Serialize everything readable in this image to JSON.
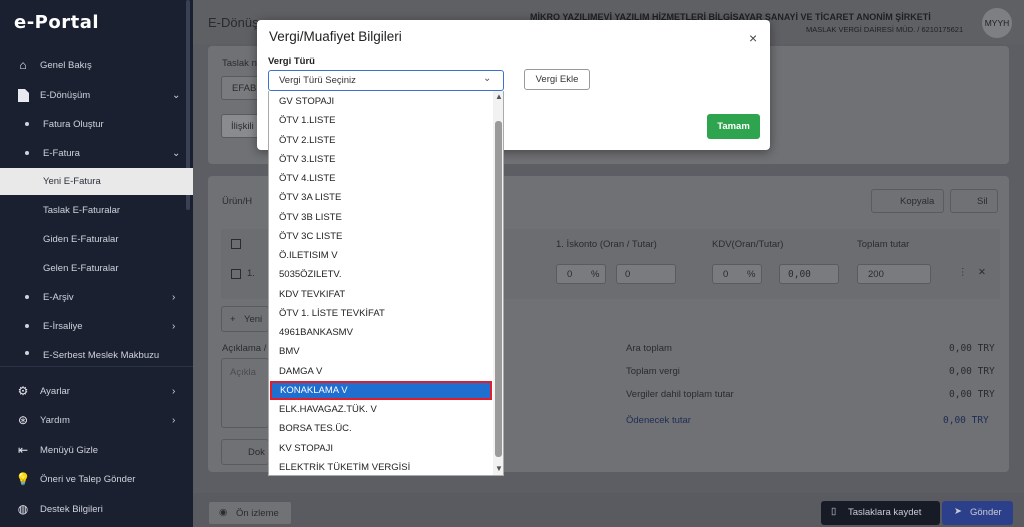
{
  "app": {
    "logo": "e-Portal"
  },
  "sidebar": {
    "items": [
      {
        "label": "Genel Bakış",
        "icon": "home-icon"
      },
      {
        "label": "E-Dönüşüm",
        "icon": "document-icon"
      },
      {
        "label": "Fatura Oluştur"
      },
      {
        "label": "E-Fatura"
      },
      {
        "label": "Yeni E-Fatura"
      },
      {
        "label": "Taslak E-Faturalar"
      },
      {
        "label": "Giden E-Faturalar"
      },
      {
        "label": "Gelen E-Faturalar"
      },
      {
        "label": "E-Arşiv"
      },
      {
        "label": "E-İrsaliye"
      },
      {
        "label": "E-Serbest Meslek Makbuzu"
      },
      {
        "label": "Ayarlar",
        "icon": "gear-icon"
      },
      {
        "label": "Yardım",
        "icon": "help-icon"
      },
      {
        "label": "Menüyü Gizle",
        "icon": "collapse-icon"
      },
      {
        "label": "Öneri ve Talep Gönder",
        "icon": "lightbulb-icon"
      },
      {
        "label": "Destek Bilgileri",
        "icon": "support-icon"
      }
    ]
  },
  "header": {
    "page_title": "E-Dönüş",
    "company": "MİKRO YAZILIMEVİ YAZILIM HİZMETLERİ BİLGİSAYAR SANAYİ VE TİCARET ANONİM ŞİRKETİ",
    "tax_office": "MASLAK VERGİ DAİRESİ MÜD. / 6210175621",
    "avatar": "MYYH"
  },
  "background": {
    "taslak_label": "Taslak n",
    "efab": "EFAB",
    "iliskili": "İlişkili",
    "products_title": "Ürün/H",
    "kopyala": "Kopyala",
    "sil": "Sil",
    "col_discount": "1. İskonto (Oran / Tutar)",
    "col_kdv": "KDV(Oran/Tutar)",
    "col_total": "Toplam tutar",
    "row_no": "1.",
    "disc_rate": "0",
    "disc_pct": "%",
    "disc_amt": "0",
    "kdv_rate": "0",
    "kdv_pct": "%",
    "kdv_amt": "0,00",
    "total_amt": "200",
    "new_row": "Yeni",
    "aciklama": "Açıklama /",
    "aciklama_ph": "Açıkla",
    "dok": "Dok",
    "ara_toplam": "Ara toplam",
    "ara_toplam_val": "0,00 TRY",
    "toplam_vergi": "Toplam vergi",
    "toplam_vergi_val": "0,00 TRY",
    "vergiler_dahil": "Vergiler dahil toplam tutar",
    "vergiler_dahil_val": "0,00 TRY",
    "odenecek": "Ödenecek tutar",
    "odenecek_val": "0,00 TRY",
    "on_izleme": "Ön izleme",
    "taslaklara_kaydet": "Taslaklara kaydet",
    "gonder": "Gönder"
  },
  "modal": {
    "title": "Vergi/Muafiyet Bilgileri",
    "close": "×",
    "tax_type_label": "Vergi Türü",
    "select_placeholder": "Vergi Türü Seçiniz",
    "add_tax": "Vergi Ekle",
    "ok": "Tamam",
    "options": [
      "GV STOPAJI",
      "ÖTV 1.LISTE",
      "ÖTV 2.LISTE",
      "ÖTV 3.LISTE",
      "ÖTV 4.LISTE",
      "ÖTV 3A LISTE",
      "ÖTV 3B LISTE",
      "ÖTV 3C LISTE",
      "Ö.ILETISIM V",
      "5035ÖZILETV.",
      "KDV TEVKIFAT",
      "ÖTV 1. LİSTE TEVKİFAT",
      "4961BANKASMV",
      "BMV",
      "DAMGA V",
      "KONAKLAMA V",
      "ELK.HAVAGAZ.TÜK. V",
      "BORSA TES.ÜC.",
      "KV STOPAJI",
      "ELEKTRİK TÜKETİM VERGİSİ"
    ],
    "selected_option": "KONAKLAMA V"
  },
  "colors": {
    "accent": "#3b5bdb",
    "ok_green": "#2ea44f",
    "highlight_red": "#e11d2b",
    "sidebar_bg": "#1b2031"
  }
}
